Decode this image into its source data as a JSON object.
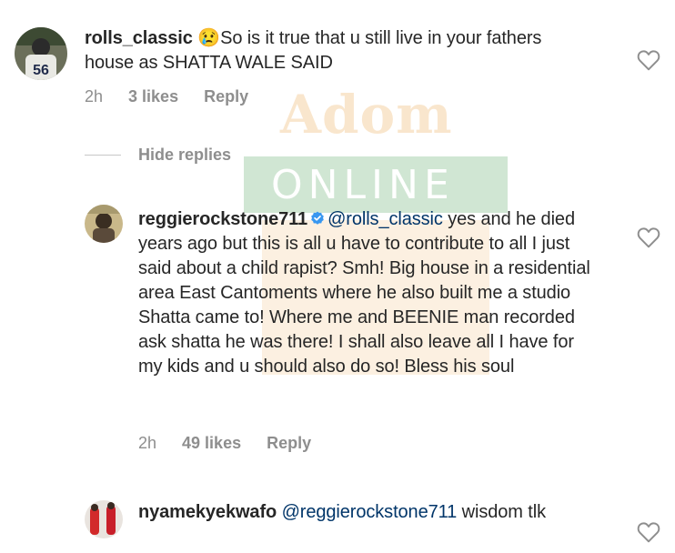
{
  "comments": [
    {
      "username": "rolls_classic",
      "emoji": "😢",
      "text": "So is it true that u still live in your fathers house as SHATTA WALE SAID",
      "time": "2h",
      "likes": "3 likes",
      "reply_label": "Reply",
      "jersey_number": "56"
    },
    {
      "username": "reggierockstone711",
      "verified": true,
      "mention": "@rolls_classic",
      "text": " yes and he died years ago but this is all u have to contribute to all I just said about a child rapist? Smh! Big house in a residential area East Cantoments where he also built me a studio Shatta came to! Where me and BEENIE man recorded ask shatta he was there! I shall also leave all I have for my kids and u should also do so! Bless his soul",
      "time": "2h",
      "likes": "49 likes",
      "reply_label": "Reply"
    },
    {
      "username": "nyamekyekwafo",
      "mention": "@reggierockstone711",
      "text": " wisdom tlk"
    }
  ],
  "hide_replies_label": "Hide replies",
  "watermark": {
    "line1": "Adom",
    "line2": "ONLINE"
  },
  "colors": {
    "username": "#262626",
    "mention": "#003569",
    "meta": "#8e8e8e",
    "verified": "#3897f0"
  }
}
